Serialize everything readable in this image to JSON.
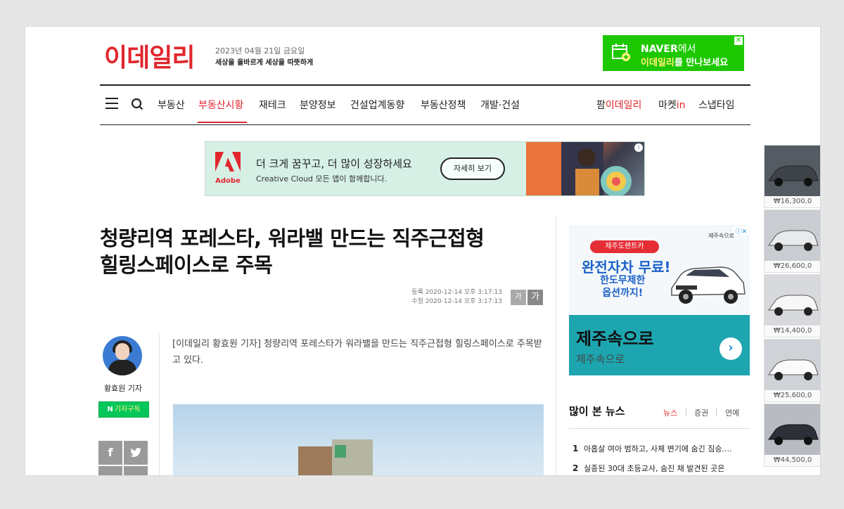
{
  "header": {
    "logo": "이데일리",
    "date": "2023년 04월 21일 금요일",
    "slogan": "세상을 올바르게 세상을 따뜻하게"
  },
  "naver_banner": {
    "line1_brand": "NAVER",
    "line1_suffix": "에서",
    "line2_highlight": "이데일리",
    "line2_suffix": "를 만나보세요",
    "close": "✕",
    "accent": "#1ec800"
  },
  "nav": {
    "items": [
      "부동산",
      "부동산시황",
      "재테크",
      "분양정보",
      "건설업계동향",
      "부동산정책",
      "개발·건설"
    ],
    "right_items": [
      {
        "prefix": "팜",
        "accent": "이데일리",
        "suffix": ""
      },
      {
        "prefix": "마켓",
        "accent": "in",
        "suffix": ""
      },
      {
        "prefix": "스냅타임",
        "accent": "",
        "suffix": ""
      }
    ],
    "accent_color": "#e1262d"
  },
  "adobe_ad": {
    "brand": "Adobe",
    "headline": "더 크게 꿈꾸고, 더 많이 성장하세요",
    "subline": "Creative Cloud 모든 앱이 함께합니다.",
    "cta": "자세히 보기"
  },
  "article": {
    "title_line1": "청량리역 포레스타, 워라밸 만드는 직주근접형",
    "title_line2": "힐링스페이스로 주목",
    "registered": "등록 2020-12-14 오후 3:17:13",
    "modified": "수정 2020-12-14 오후 3:17:13",
    "font_small": "가",
    "font_large": "가",
    "lead": "[이데일리 황효원 기자] 청량리역 포레스타가 워라밸을 만드는 직주근접형 힐링스페이스로 주목받고 있다."
  },
  "reporter": {
    "name": "황효원 기자",
    "subscribe_n": "N",
    "subscribe_label": "기자구독"
  },
  "share": {
    "facebook": "f",
    "twitter": "🐦"
  },
  "rent_ad": {
    "badge": "제주도렌트카",
    "brand": "제주속으로",
    "big": "완전자차 무료!",
    "small_line1": "한도무제한",
    "small_line2": "옵션까지!",
    "name": "제주속으로",
    "sub": "제주속으로",
    "arrow": "›",
    "adchoices": "ⓘ✕"
  },
  "most_viewed": {
    "title": "많이 본 뉴스",
    "tabs": [
      "뉴스",
      "증권",
      "연예"
    ],
    "items": [
      {
        "rank": "1",
        "text": "아홉살 여아 범하고, 사체 변기에 숨긴 짐승...."
      },
      {
        "rank": "2",
        "text": "실종된 30대 초등교사, 숨진 채 발견된 곳은"
      }
    ]
  },
  "car_ads": [
    {
      "price": "₩16,300,0"
    },
    {
      "price": "₩26,600,0"
    },
    {
      "price": "₩14,400,0"
    },
    {
      "price": "₩25,600,0"
    },
    {
      "price": "₩44,500,0"
    }
  ]
}
